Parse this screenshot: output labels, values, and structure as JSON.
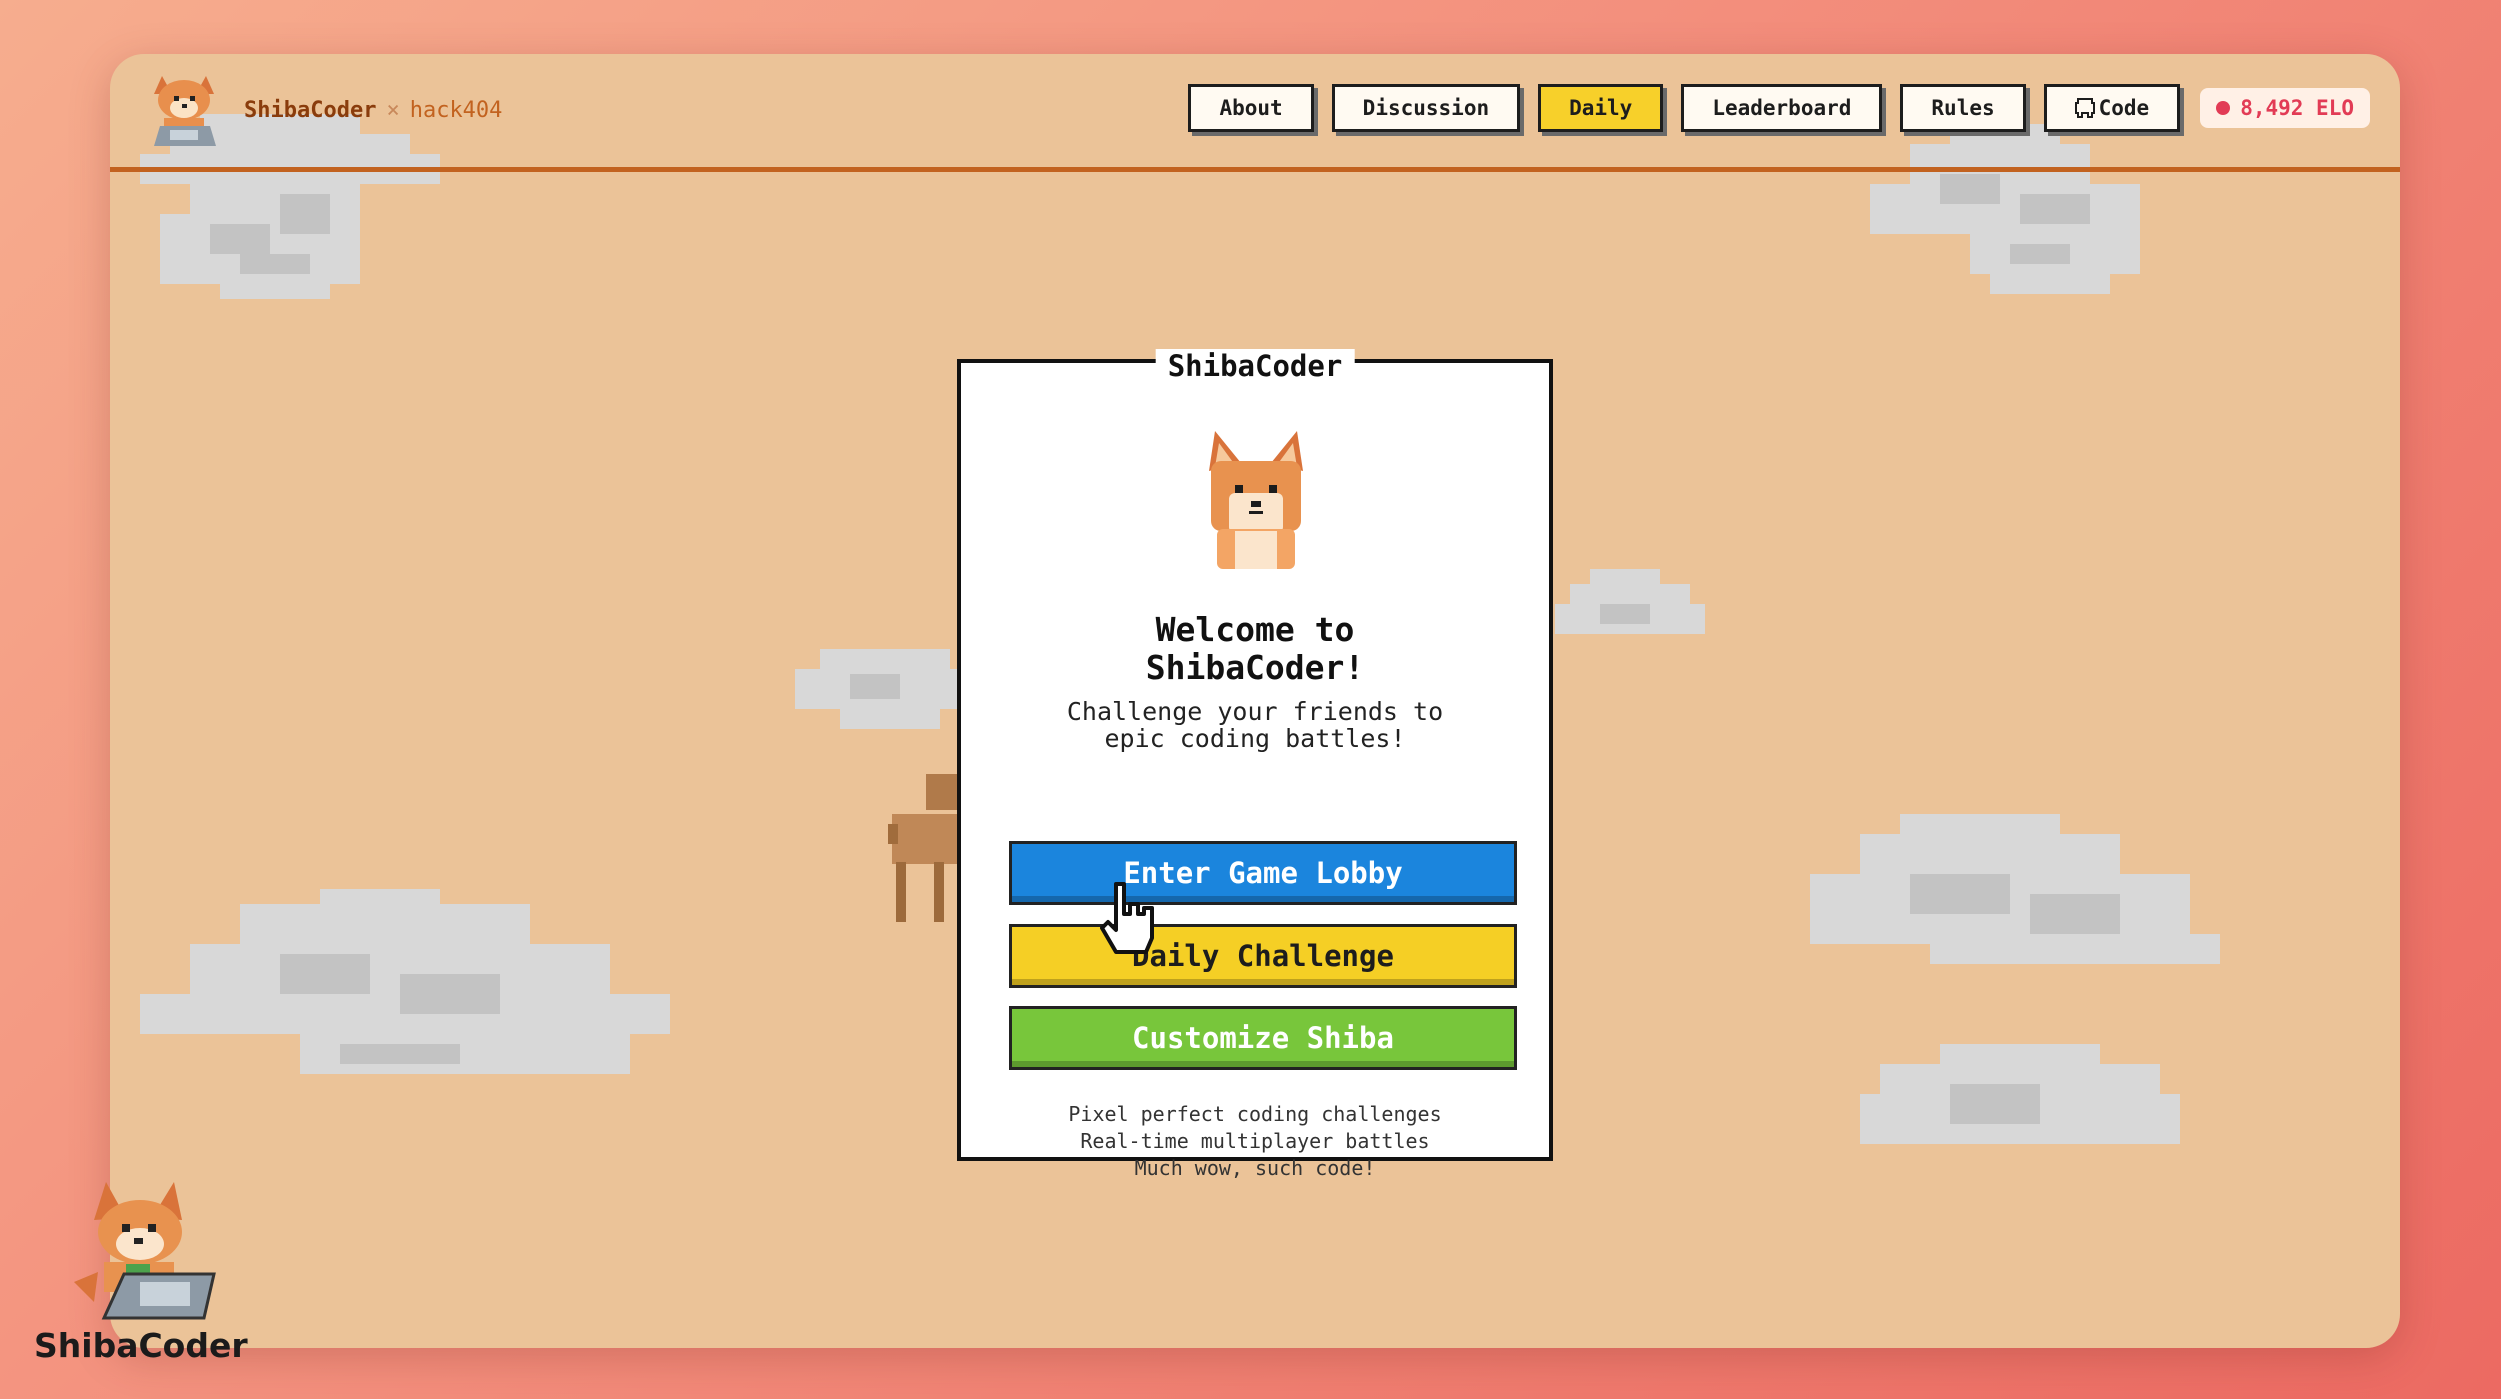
{
  "brand": {
    "name": "ShibaCoder",
    "separator": "×",
    "team": "hack404"
  },
  "nav": {
    "items": [
      {
        "label": "About"
      },
      {
        "label": "Discussion"
      },
      {
        "label": "Daily"
      },
      {
        "label": "Leaderboard"
      },
      {
        "label": "Rules"
      },
      {
        "label": "Code",
        "icon": "github-icon"
      }
    ],
    "active": "Daily",
    "elo": "8,492 ELO"
  },
  "card": {
    "title": "ShibaCoder",
    "welcome_line1": "Welcome to",
    "welcome_line2": "ShibaCoder!",
    "tagline_line1": "Challenge your friends to",
    "tagline_line2": "epic coding battles!",
    "buttons": {
      "lobby": "Enter Game Lobby",
      "daily": "Daily Challenge",
      "customize": "Customize Shiba"
    },
    "features": [
      "Pixel perfect coding challenges",
      "Real-time multiplayer battles",
      "Much wow, such code!"
    ]
  },
  "watermark": {
    "text": "ShibaCoder"
  },
  "colors": {
    "background_gradient": [
      "#f6ad8e",
      "#ec6a62"
    ],
    "window": "#ebc398",
    "accent": "#c2621f",
    "lobby_button": "#1b85dd",
    "daily_button": "#f5cf25",
    "customize_button": "#78c63b",
    "elo": "#e23b55"
  }
}
